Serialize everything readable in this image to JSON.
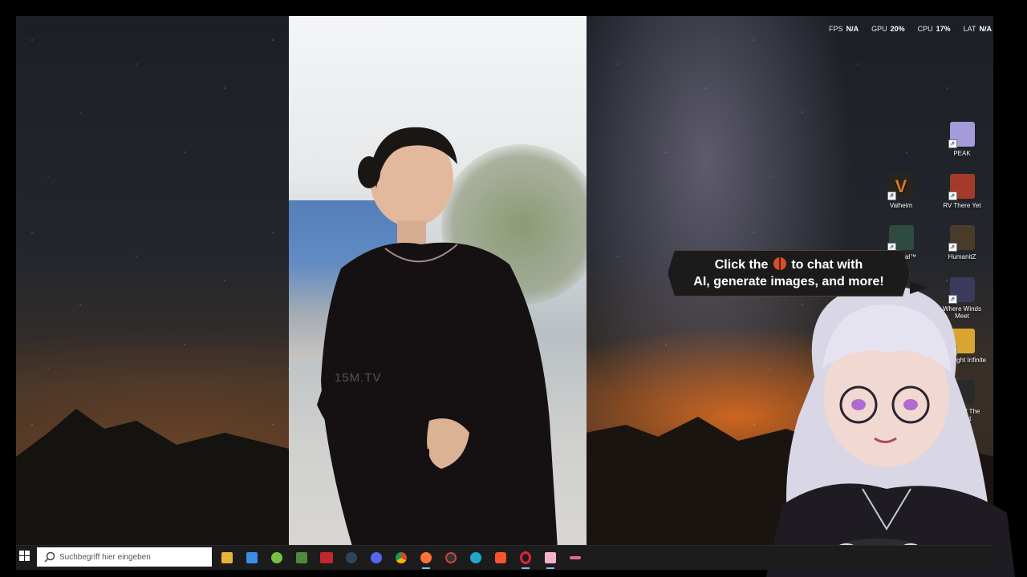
{
  "perf_overlay": {
    "fps_label": "FPS",
    "fps_value": "N/A",
    "gpu_label": "GPU",
    "gpu_value": "20%",
    "cpu_label": "CPU",
    "cpu_value": "17%",
    "lat_label": "LAT",
    "lat_value": "N/A"
  },
  "video": {
    "watermark": "15M.TV"
  },
  "desktop_icons": [
    {
      "name": "PEAK",
      "icon": "peak-game-icon",
      "color": "#a49bd8"
    },
    {
      "name": "Valheim",
      "icon": "valheim-game-icon",
      "color": "#2a2420"
    },
    {
      "name": "RV There Yet",
      "icon": "rv-there-yet-game-icon",
      "color": "#a33a2a"
    },
    {
      "name": "Returnal™",
      "icon": "returnal-game-icon",
      "color": "#2f4a3f"
    },
    {
      "name": "HumanitZ",
      "icon": "humanitz-game-icon",
      "color": "#4a3a2a"
    },
    {
      "name": "Where Winds Meet",
      "icon": "where-winds-meet-game-icon",
      "color": "#3a3a5a"
    },
    {
      "name": "Torchlight Infinite",
      "icon": "torchlight-game-icon",
      "color": "#d8a630"
    },
    {
      "name": "Sons Of The Forest",
      "icon": "sons-of-the-forest-game-icon",
      "color": "#2a2a2a"
    }
  ],
  "assistant_bubble": {
    "line1_before": "Click the",
    "line1_after": "to chat with",
    "line2": "AI, generate images, and more!"
  },
  "taskbar": {
    "search_placeholder": "Suchbegriff hier eingeben",
    "apps": [
      {
        "name": "file-explorer-icon",
        "color": "#e8b436"
      },
      {
        "name": "microsoft-store-icon",
        "color": "#3a8ee6"
      },
      {
        "name": "android-app-icon",
        "color": "#7ac142"
      },
      {
        "name": "minecraft-icon",
        "color": "#4e8a3b"
      },
      {
        "name": "news-app-icon",
        "color": "#c0282d"
      },
      {
        "name": "steam-icon",
        "color": "#2a475e"
      },
      {
        "name": "discord-icon",
        "color": "#5865f2"
      },
      {
        "name": "chrome-icon",
        "color": "#e0b030"
      },
      {
        "name": "firefox-icon",
        "color": "#ff7139"
      },
      {
        "name": "performance-monitor-icon",
        "color": "#d04040"
      },
      {
        "name": "edge-browser-icon",
        "color": "#1fa8c9"
      },
      {
        "name": "brave-browser-icon",
        "color": "#fb542b"
      },
      {
        "name": "opera-gx-icon",
        "color": "#e0223a"
      },
      {
        "name": "photo-viewer-icon",
        "color": "#f3b3c6"
      },
      {
        "name": "pink-app-icon",
        "color": "#e06a90"
      }
    ]
  }
}
